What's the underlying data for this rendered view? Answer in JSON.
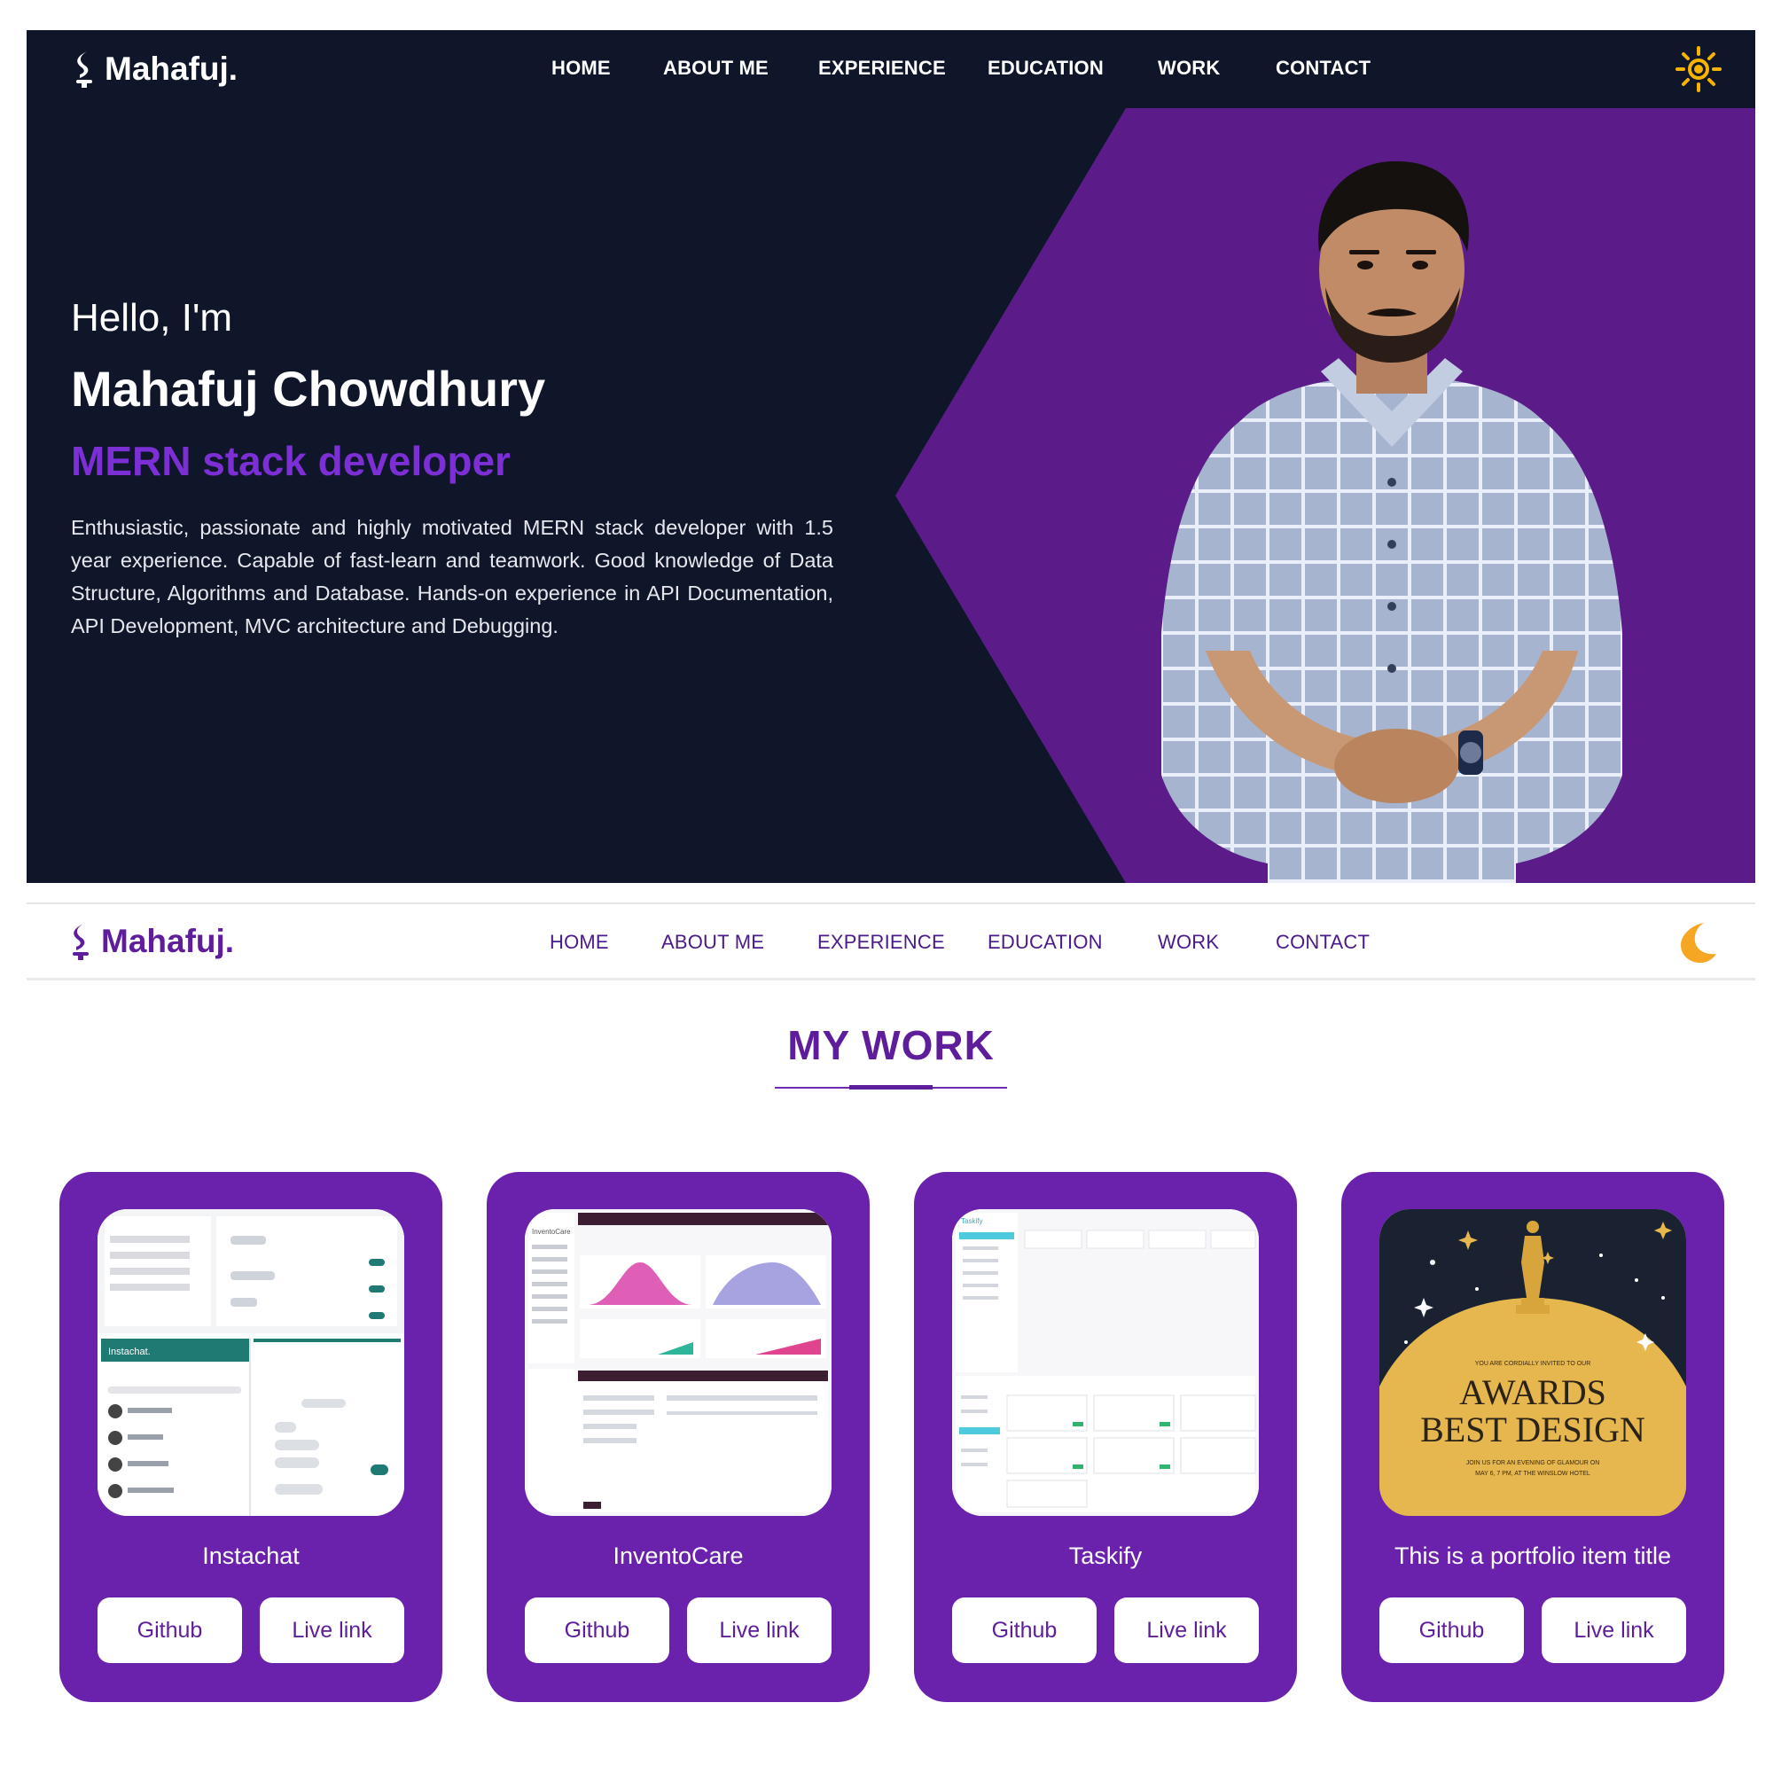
{
  "dark_view": {
    "logo_text": "Mahafuj.",
    "nav": [
      "HOME",
      "ABOUT ME",
      "EXPERIENCE",
      "EDUCATION",
      "WORK",
      "CONTACT"
    ],
    "theme_toggle_icon": "sun-icon",
    "hero": {
      "greeting": "Hello, I'm",
      "name": "Mahafuj Chowdhury",
      "role": "MERN stack developer",
      "description": "Enthusiastic, passionate and highly motivated MERN stack developer with 1.5 year experience. Capable of fast-learn and teamwork. Good knowledge of Data Structure, Algorithms and Database. Hands-on experience in API Documentation, API Development, MVC architecture and Debugging."
    }
  },
  "light_view": {
    "logo_text": "Mahafuj.",
    "nav": [
      "HOME",
      "ABOUT ME",
      "EXPERIENCE",
      "EDUCATION",
      "WORK",
      "CONTACT"
    ],
    "theme_toggle_icon": "moon-icon",
    "section_title": "MY WORK",
    "projects": [
      {
        "title": "Instachat",
        "github_label": "Github",
        "live_label": "Live link"
      },
      {
        "title": "InventoCare",
        "github_label": "Github",
        "live_label": "Live link"
      },
      {
        "title": "Taskify",
        "github_label": "Github",
        "live_label": "Live link"
      },
      {
        "title": "This is a portfolio item title",
        "github_label": "Github",
        "live_label": "Live link"
      }
    ],
    "award_thumb": {
      "invite_line": "YOU ARE CORDIALLY INVITED TO OUR",
      "heading_1": "AWARDS",
      "heading_2": "BEST DESIGN",
      "detail_1": "JOIN US FOR AN EVENING OF GLAMOUR ON",
      "detail_2": "MAY 6, 7 PM, AT THE WINSLOW HOTEL"
    },
    "thumb_texts": {
      "instachat_brand": "Instachat.",
      "inventocare_brand": "InventoCare",
      "taskify_brand": "Taskify"
    }
  },
  "colors": {
    "dark_bg": "#0f1629",
    "accent_purple": "#5b1c8a",
    "role_purple": "#7b2fd4",
    "card_purple": "#6a22ad",
    "sun_yellow": "#f6b400",
    "moon_orange": "#f5a623"
  }
}
